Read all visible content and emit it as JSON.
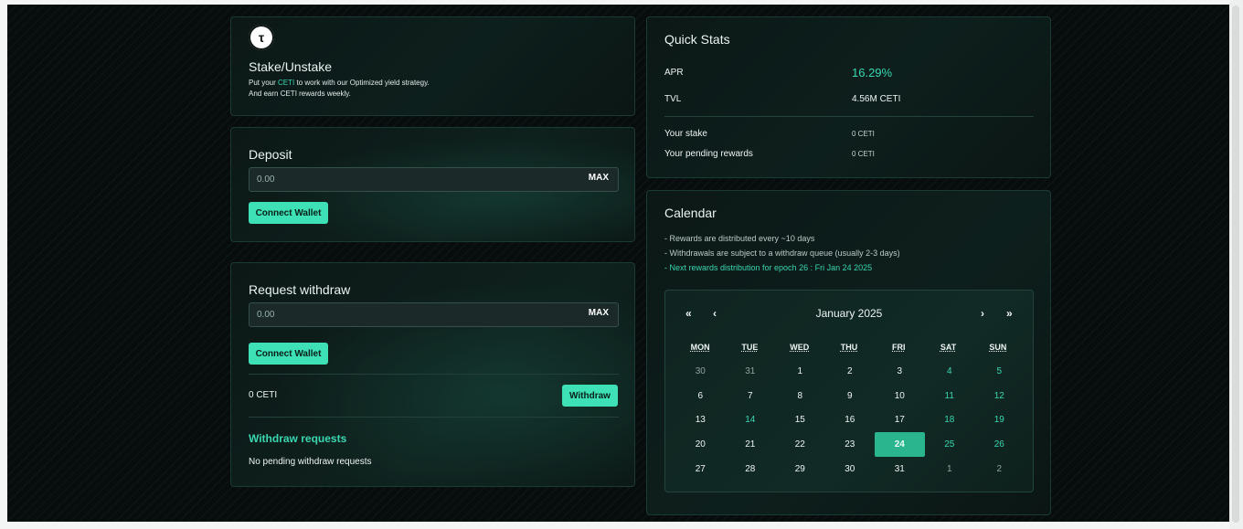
{
  "stake": {
    "logo_glyph": "τ",
    "title": "Stake/Unstake",
    "desc_line1_a": "Put your ",
    "desc_line1_token": "CETI",
    "desc_line1_b": " to work with our Optimized yield strategy.",
    "desc_line2": "And earn CETI rewards weekly."
  },
  "deposit": {
    "title": "Deposit",
    "placeholder": "0.00",
    "max_label": "MAX",
    "button_label": "Connect Wallet"
  },
  "withdraw": {
    "title": "Request withdraw",
    "placeholder": "0.00",
    "max_label": "MAX",
    "connect_label": "Connect Wallet",
    "balance": "0 CETI",
    "withdraw_label": "Withdraw",
    "requests_title": "Withdraw requests",
    "requests_empty": "No pending withdraw requests"
  },
  "stats": {
    "title": "Quick Stats",
    "apr_label": "APR",
    "apr_value": "16.29%",
    "tvl_label": "TVL",
    "tvl_value": "4.56M CETI",
    "stake_label": "Your stake",
    "stake_value": "0 CETI",
    "rewards_label": "Your pending rewards",
    "rewards_value": "0 CETI"
  },
  "calendar": {
    "title": "Calendar",
    "line1": "- Rewards are distributed every ~10 days",
    "line2": "- Withdrawals are subject to a withdraw queue (usually 2-3 days)",
    "line3": "- Next rewards distribution for epoch 26 : Fri Jan 24 2025",
    "month_label": "January 2025",
    "nav_prev_year": "«",
    "nav_prev_month": "‹",
    "nav_next_month": "›",
    "nav_next_year": "»",
    "weekdays": [
      "MON",
      "TUE",
      "WED",
      "THU",
      "FRI",
      "SAT",
      "SUN"
    ],
    "weeks": [
      [
        "30",
        "31",
        "1",
        "2",
        "3",
        "4",
        "5"
      ],
      [
        "6",
        "7",
        "8",
        "9",
        "10",
        "11",
        "12"
      ],
      [
        "13",
        "14",
        "15",
        "16",
        "17",
        "18",
        "19"
      ],
      [
        "20",
        "21",
        "22",
        "23",
        "24",
        "25",
        "26"
      ],
      [
        "27",
        "28",
        "29",
        "30",
        "31",
        "1",
        "2"
      ]
    ],
    "outside_month": [
      [
        0,
        0
      ],
      [
        0,
        1
      ],
      [
        4,
        5
      ],
      [
        4,
        6
      ]
    ],
    "highlighted": [
      [
        0,
        5
      ],
      [
        0,
        6
      ],
      [
        1,
        5
      ],
      [
        1,
        6
      ],
      [
        2,
        1
      ],
      [
        2,
        5
      ],
      [
        2,
        6
      ],
      [
        3,
        5
      ],
      [
        3,
        6
      ]
    ],
    "selected": [
      3,
      4
    ],
    "colors": {
      "accent": "#3ad7b1",
      "selected_bg": "#2bb58f"
    }
  }
}
